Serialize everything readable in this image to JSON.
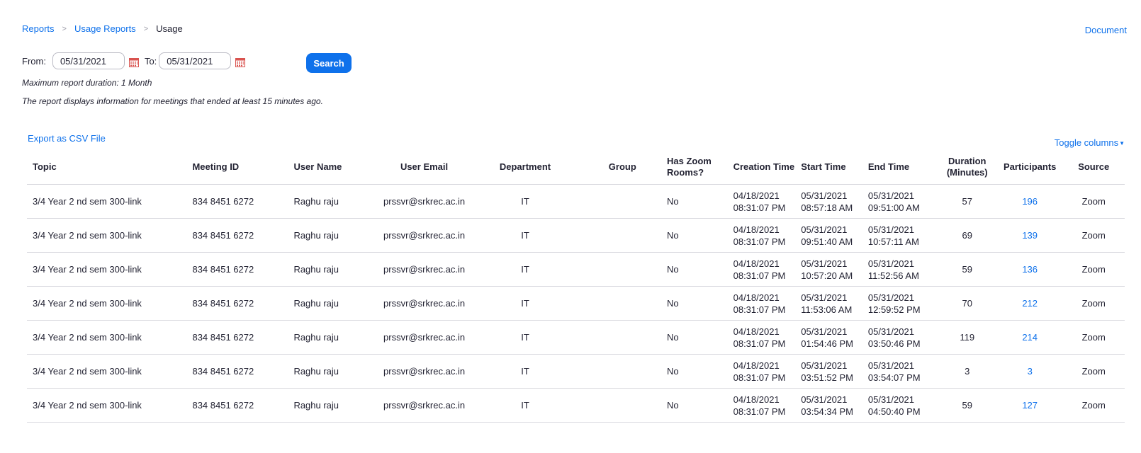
{
  "breadcrumb": {
    "items": [
      "Reports",
      "Usage Reports"
    ],
    "current": "Usage",
    "separator": ">"
  },
  "header": {
    "document_link": "Document"
  },
  "filters": {
    "from_label": "From:",
    "from_value": "05/31/2021",
    "to_label": "To:",
    "to_value": "05/31/2021",
    "search_label": "Search"
  },
  "notes": {
    "max_duration": "Maximum report duration: 1 Month",
    "info": "The report displays information for meetings that ended at least 15 minutes ago."
  },
  "actions": {
    "export_label": "Export as CSV File",
    "toggle_columns_label": "Toggle columns"
  },
  "table": {
    "headers": {
      "topic": "Topic",
      "meeting_id": "Meeting ID",
      "user_name": "User Name",
      "user_email": "User Email",
      "department": "Department",
      "group": "Group",
      "has_zoom_rooms_1": "Has Zoom",
      "has_zoom_rooms_2": "Rooms?",
      "creation_time": "Creation Time",
      "start_time": "Start Time",
      "end_time": "End Time",
      "duration_1": "Duration",
      "duration_2": "(Minutes)",
      "participants": "Participants",
      "source": "Source"
    },
    "rows": [
      {
        "topic": "3/4 Year 2 nd sem 300-link",
        "meeting_id": "834 8451 6272",
        "user_name": "Raghu raju",
        "user_email": "prssvr@srkrec.ac.in",
        "department": "IT",
        "group": "",
        "has_zoom_rooms": "No",
        "creation_date": "04/18/2021",
        "creation_clock": "08:31:07 PM",
        "start_date": "05/31/2021",
        "start_clock": "08:57:18 AM",
        "end_date": "05/31/2021",
        "end_clock": "09:51:00 AM",
        "duration": "57",
        "participants": "196",
        "source": "Zoom"
      },
      {
        "topic": "3/4 Year 2 nd sem 300-link",
        "meeting_id": "834 8451 6272",
        "user_name": "Raghu raju",
        "user_email": "prssvr@srkrec.ac.in",
        "department": "IT",
        "group": "",
        "has_zoom_rooms": "No",
        "creation_date": "04/18/2021",
        "creation_clock": "08:31:07 PM",
        "start_date": "05/31/2021",
        "start_clock": "09:51:40 AM",
        "end_date": "05/31/2021",
        "end_clock": "10:57:11 AM",
        "duration": "69",
        "participants": "139",
        "source": "Zoom"
      },
      {
        "topic": "3/4 Year 2 nd sem 300-link",
        "meeting_id": "834 8451 6272",
        "user_name": "Raghu raju",
        "user_email": "prssvr@srkrec.ac.in",
        "department": "IT",
        "group": "",
        "has_zoom_rooms": "No",
        "creation_date": "04/18/2021",
        "creation_clock": "08:31:07 PM",
        "start_date": "05/31/2021",
        "start_clock": "10:57:20 AM",
        "end_date": "05/31/2021",
        "end_clock": "11:52:56 AM",
        "duration": "59",
        "participants": "136",
        "source": "Zoom"
      },
      {
        "topic": "3/4 Year 2 nd sem 300-link",
        "meeting_id": "834 8451 6272",
        "user_name": "Raghu raju",
        "user_email": "prssvr@srkrec.ac.in",
        "department": "IT",
        "group": "",
        "has_zoom_rooms": "No",
        "creation_date": "04/18/2021",
        "creation_clock": "08:31:07 PM",
        "start_date": "05/31/2021",
        "start_clock": "11:53:06 AM",
        "end_date": "05/31/2021",
        "end_clock": "12:59:52 PM",
        "duration": "70",
        "participants": "212",
        "source": "Zoom"
      },
      {
        "topic": "3/4 Year 2 nd sem 300-link",
        "meeting_id": "834 8451 6272",
        "user_name": "Raghu raju",
        "user_email": "prssvr@srkrec.ac.in",
        "department": "IT",
        "group": "",
        "has_zoom_rooms": "No",
        "creation_date": "04/18/2021",
        "creation_clock": "08:31:07 PM",
        "start_date": "05/31/2021",
        "start_clock": "01:54:46 PM",
        "end_date": "05/31/2021",
        "end_clock": "03:50:46 PM",
        "duration": "119",
        "participants": "214",
        "source": "Zoom"
      },
      {
        "topic": "3/4 Year 2 nd sem 300-link",
        "meeting_id": "834 8451 6272",
        "user_name": "Raghu raju",
        "user_email": "prssvr@srkrec.ac.in",
        "department": "IT",
        "group": "",
        "has_zoom_rooms": "No",
        "creation_date": "04/18/2021",
        "creation_clock": "08:31:07 PM",
        "start_date": "05/31/2021",
        "start_clock": "03:51:52 PM",
        "end_date": "05/31/2021",
        "end_clock": "03:54:07 PM",
        "duration": "3",
        "participants": "3",
        "source": "Zoom"
      },
      {
        "topic": "3/4 Year 2 nd sem 300-link",
        "meeting_id": "834 8451 6272",
        "user_name": "Raghu raju",
        "user_email": "prssvr@srkrec.ac.in",
        "department": "IT",
        "group": "",
        "has_zoom_rooms": "No",
        "creation_date": "04/18/2021",
        "creation_clock": "08:31:07 PM",
        "start_date": "05/31/2021",
        "start_clock": "03:54:34 PM",
        "end_date": "05/31/2021",
        "end_clock": "04:50:40 PM",
        "duration": "59",
        "participants": "127",
        "source": "Zoom"
      }
    ]
  },
  "colors": {
    "link": "#0e71eb",
    "text": "#232333",
    "border": "#d8d8de",
    "calendar_icon": "#d9534f"
  },
  "icons": {
    "calendar": "calendar-icon",
    "caret": "caret-down-icon"
  }
}
